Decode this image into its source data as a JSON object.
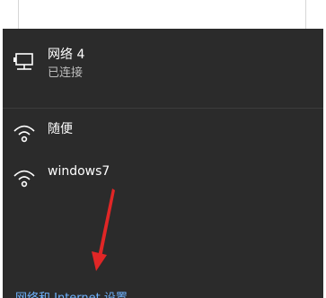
{
  "flyout": {
    "connected_network": {
      "name": "网络 4",
      "status": "已连接",
      "icon": "wired-ethernet-icon"
    },
    "wifi_networks": [
      {
        "name": "随便",
        "icon": "wifi-signal-icon"
      },
      {
        "name": "windows7",
        "icon": "wifi-signal-icon"
      }
    ],
    "settings_link": "网络和 Internet 设置"
  },
  "colors": {
    "panel_background": "#2b2b2b",
    "link": "#6fb3ff",
    "annotation_arrow": "#e02626"
  }
}
